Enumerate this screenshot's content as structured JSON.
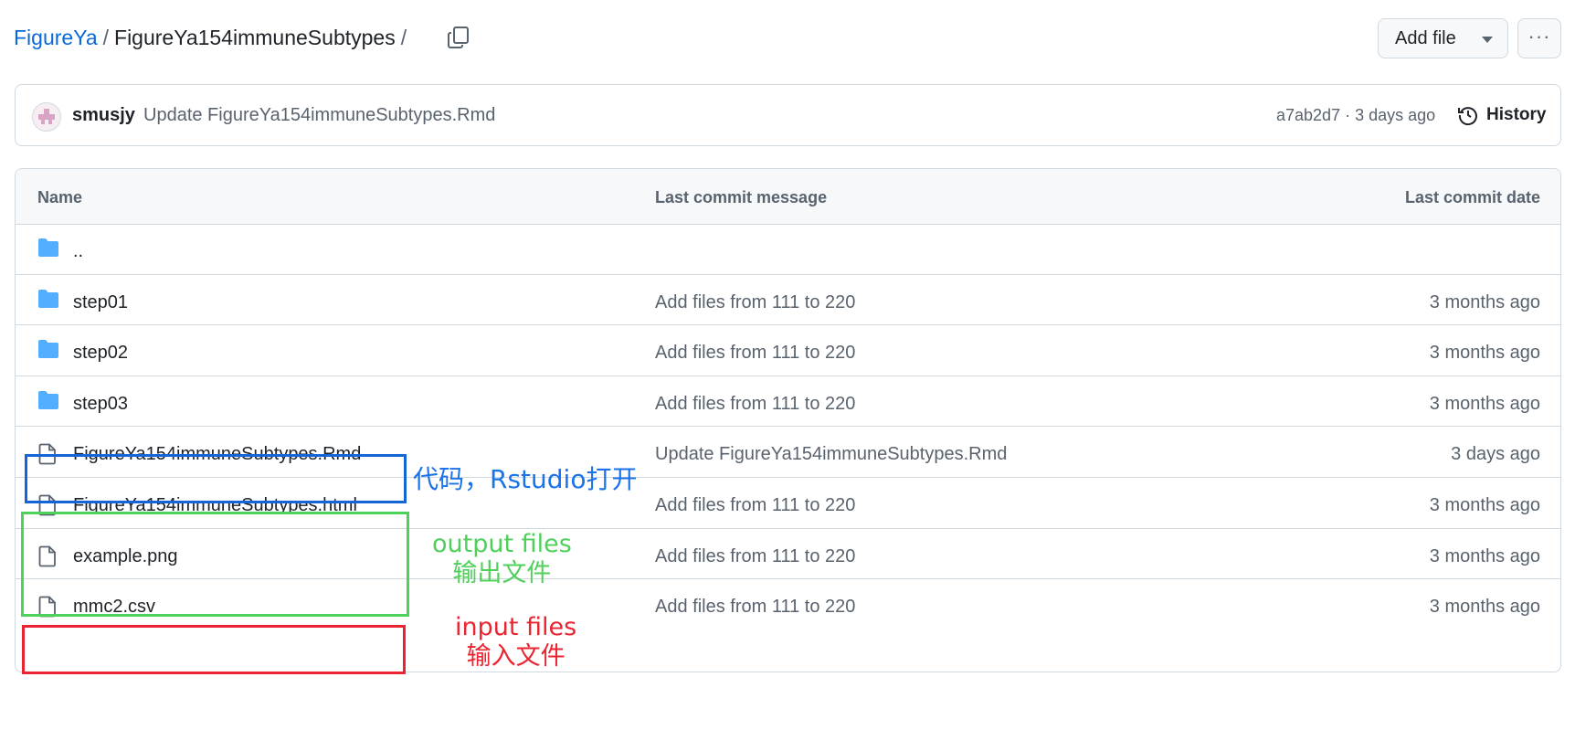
{
  "breadcrumb": {
    "repo": "FigureYa",
    "separator": "/",
    "directory": "FigureYa154immuneSubtypes",
    "trailing_separator": "/"
  },
  "toolbar": {
    "add_file_label": "Add file",
    "more_label": "···"
  },
  "commit": {
    "user": "smusjy",
    "message": "Update FigureYa154immuneSubtypes.Rmd",
    "meta": "a7ab2d7 · 3 days ago",
    "history_label": "History"
  },
  "table": {
    "headers": [
      "Name",
      "Last commit message",
      "Last commit date"
    ],
    "rows": [
      {
        "type": "folder",
        "name": "..",
        "message": "",
        "date": ""
      },
      {
        "type": "folder",
        "name": "step01",
        "message": "Add files from 111 to 220",
        "date": "3 months ago"
      },
      {
        "type": "folder",
        "name": "step02",
        "message": "Add files from 111 to 220",
        "date": "3 months ago"
      },
      {
        "type": "folder",
        "name": "step03",
        "message": "Add files from 111 to 220",
        "date": "3 months ago"
      },
      {
        "type": "file",
        "name": "FigureYa154immuneSubtypes.Rmd",
        "message": "Update FigureYa154immuneSubtypes.Rmd",
        "date": "3 days ago"
      },
      {
        "type": "file",
        "name": "FigureYa154immuneSubtypes.html",
        "message": "Add files from 111 to 220",
        "date": "3 months ago"
      },
      {
        "type": "file",
        "name": "example.png",
        "message": "Add files from 111 to 220",
        "date": "3 months ago"
      },
      {
        "type": "file",
        "name": "mmc2.csv",
        "message": "Add files from 111 to 220",
        "date": "3 months ago"
      }
    ]
  },
  "annotations": {
    "code": "代码，Rstudio打开",
    "output_line1": "output files",
    "output_line2": "输出文件",
    "input_line1": "input files",
    "input_line2": "输入文件"
  },
  "colors": {
    "link": "#0969da",
    "folder": "#54aeff",
    "annotation_blue": "#1565d8",
    "annotation_green": "#4cd25a",
    "annotation_red": "#ea2431"
  }
}
